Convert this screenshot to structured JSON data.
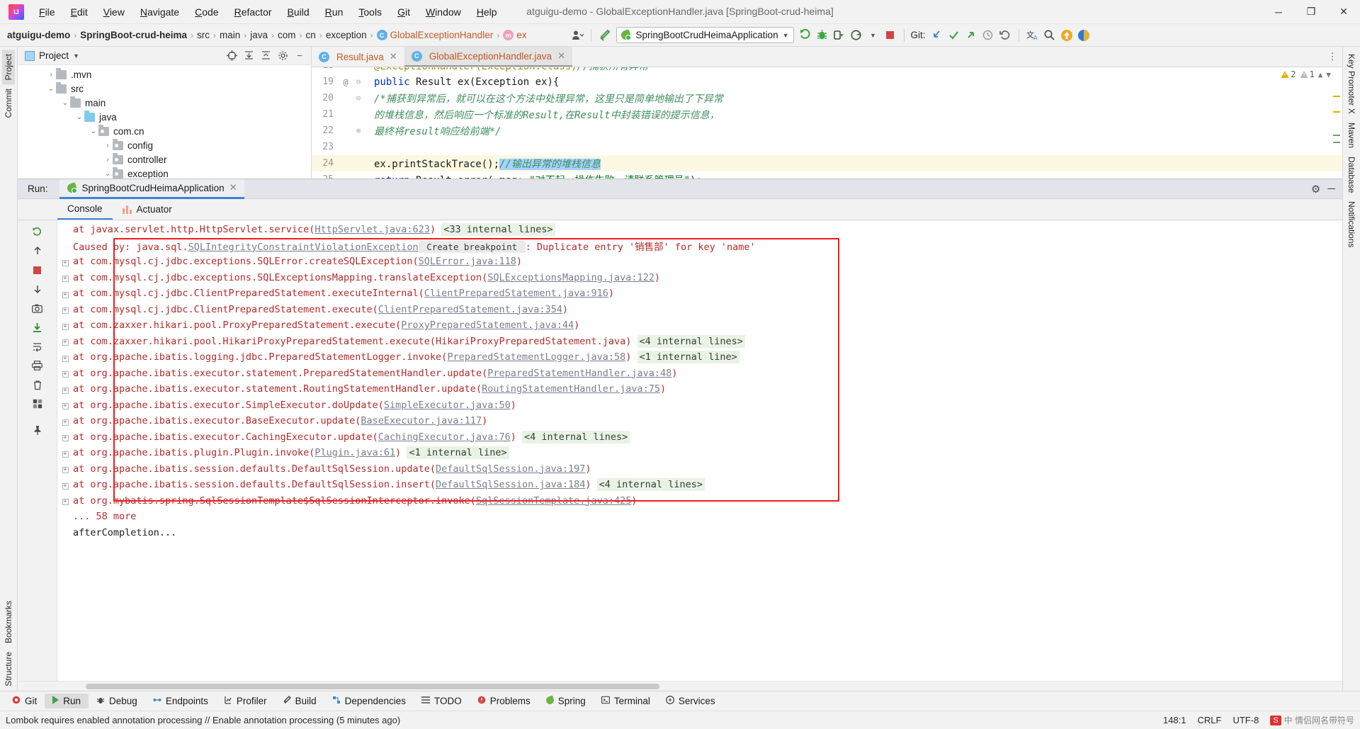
{
  "titlebar": {
    "logo": "intellij-logo",
    "window_title": "atguigu-demo - GlobalExceptionHandler.java [SpringBoot-crud-heima]",
    "menus": [
      "File",
      "Edit",
      "View",
      "Navigate",
      "Code",
      "Refactor",
      "Build",
      "Run",
      "Tools",
      "Git",
      "Window",
      "Help"
    ],
    "minimize": "─",
    "maximize": "❐",
    "close": "✕"
  },
  "navbar": {
    "breadcrumbs": [
      {
        "label": "atguigu-demo",
        "bold": true
      },
      {
        "label": "SpringBoot-crud-heima",
        "bold": true
      },
      {
        "label": "src",
        "bold": false
      },
      {
        "label": "main",
        "bold": false
      },
      {
        "label": "java",
        "bold": false
      },
      {
        "label": "com",
        "bold": false
      },
      {
        "label": "cn",
        "bold": false
      },
      {
        "label": "exception",
        "bold": false
      }
    ],
    "class_crumb": {
      "icon": "C",
      "label": "GlobalExceptionHandler"
    },
    "method_crumb": {
      "icon": "m",
      "label": "ex"
    },
    "run_config": "SpringBootCrudHeimaApplication",
    "git_label": "Git:",
    "separator": "›"
  },
  "left_stripe": {
    "items": [
      "Project",
      "Commit"
    ],
    "selected": "Project",
    "bottom_items": [
      "Bookmarks",
      "Structure"
    ]
  },
  "right_stripe": {
    "items": [
      "Key Promoter X",
      "Maven",
      "Database",
      "Notifications"
    ]
  },
  "project_panel": {
    "title": "Project",
    "tree": [
      {
        "label": ".mvn",
        "indent": 2,
        "arrow": "›",
        "kind": "folder"
      },
      {
        "label": "src",
        "indent": 2,
        "arrow": "⌄",
        "kind": "folder"
      },
      {
        "label": "main",
        "indent": 3,
        "arrow": "⌄",
        "kind": "folder"
      },
      {
        "label": "java",
        "indent": 4,
        "arrow": "⌄",
        "kind": "source"
      },
      {
        "label": "com.cn",
        "indent": 5,
        "arrow": "⌄",
        "kind": "package"
      },
      {
        "label": "config",
        "indent": 6,
        "arrow": "›",
        "kind": "package"
      },
      {
        "label": "controller",
        "indent": 6,
        "arrow": "›",
        "kind": "package"
      },
      {
        "label": "exception",
        "indent": 6,
        "arrow": "⌄",
        "kind": "package"
      }
    ]
  },
  "editor": {
    "tabs": [
      {
        "label": "Result.java",
        "icon": "C",
        "active": false
      },
      {
        "label": "GlobalExceptionHandler.java",
        "icon": "C",
        "active": true
      }
    ],
    "warnings": {
      "warn_count": "2",
      "weak_count": "1",
      "warn_icon": "⚠",
      "weak_icon": "⚠"
    },
    "lines": [
      {
        "num": "18",
        "mark": "",
        "fold": "",
        "highlight": false,
        "clipped": true,
        "segments": [
          {
            "t": "    ",
            "c": "plain"
          },
          {
            "t": "@ExceptionHandler(Exception.class)",
            "c": "ann"
          },
          {
            "t": "//捕获所有异常",
            "c": "cmt"
          }
        ]
      },
      {
        "num": "19",
        "mark": "@",
        "fold": "⊖",
        "highlight": false,
        "segments": [
          {
            "t": "    ",
            "c": "plain"
          },
          {
            "t": "public",
            "c": "kw"
          },
          {
            "t": " Result ",
            "c": "plain"
          },
          {
            "t": "ex",
            "c": "plain"
          },
          {
            "t": "(Exception ex){",
            "c": "plain"
          }
        ]
      },
      {
        "num": "20",
        "mark": "",
        "fold": "⊖",
        "highlight": false,
        "segments": [
          {
            "t": "        ",
            "c": "plain"
          },
          {
            "t": "/*捕获到异常后，就可以在这个方法中处理异常，这里只是简单地输出了下异常",
            "c": "cmt"
          }
        ]
      },
      {
        "num": "21",
        "mark": "",
        "fold": "",
        "highlight": false,
        "segments": [
          {
            "t": "        ",
            "c": "plain"
          },
          {
            "t": "的堆栈信息，然后响应一个标准的Result,在Result中封装错误的提示信息，",
            "c": "cmt"
          }
        ]
      },
      {
        "num": "22",
        "mark": "",
        "fold": "⊕",
        "highlight": false,
        "segments": [
          {
            "t": "        ",
            "c": "plain"
          },
          {
            "t": "最终将result响应给前端*/",
            "c": "cmt"
          }
        ]
      },
      {
        "num": "23",
        "mark": "",
        "fold": "",
        "highlight": false,
        "segments": []
      },
      {
        "num": "24",
        "mark": "",
        "fold": "",
        "highlight": true,
        "segments": [
          {
            "t": "        ",
            "c": "plain"
          },
          {
            "t": "ex.printStackTrace();",
            "c": "plain"
          },
          {
            "t": "//输出异常的堆栈信息",
            "c": "cmtsel"
          }
        ]
      },
      {
        "num": "25",
        "mark": "",
        "fold": "",
        "highlight": false,
        "clipped": true,
        "segments": [
          {
            "t": "        ",
            "c": "plain"
          },
          {
            "t": "return",
            "c": "kw"
          },
          {
            "t": " Result.error( msg: ",
            "c": "plain"
          },
          {
            "t": "\"对不起，操作失败，请联系管理员\"",
            "c": "str"
          },
          {
            "t": ");",
            "c": "plain"
          }
        ]
      }
    ]
  },
  "run_window": {
    "header_label": "Run:",
    "tab_label": "SpringBootCrudHeimaApplication",
    "tab_close": "✕",
    "settings_icon": "⚙",
    "minimize_icon": "─",
    "subtabs": [
      {
        "label": "Console",
        "active": true,
        "icon": ""
      },
      {
        "label": "Actuator",
        "active": false,
        "icon": "actuator-icon"
      }
    ],
    "side_buttons": [
      "rerun-icon",
      "up-arrow-icon",
      "stop-icon",
      "down-arrow-icon",
      "camera-icon",
      "scroll-to-end-icon",
      "soft-wrap-icon",
      "print-icon",
      "trash-icon",
      "grid-icon",
      "pin-icon"
    ],
    "console_lines": [
      {
        "fold": false,
        "highlight": false,
        "parts": [
          {
            "t": "    at javax.servlet.http.HttpServlet.service(",
            "c": "red"
          },
          {
            "t": "HttpServlet.java:623",
            "c": "link"
          },
          {
            "t": ")",
            "c": "red"
          },
          {
            "t": "  ",
            "c": "red"
          },
          {
            "t": "<33 internal lines>",
            "c": "green"
          }
        ]
      },
      {
        "fold": false,
        "highlight": false,
        "parts": [
          {
            "t": "Caused by: java.sql.",
            "c": "red"
          },
          {
            "t": "SQLIntegrityConstraintViolationException",
            "c": "link"
          },
          {
            "t": " Create breakpoint ",
            "c": "bp"
          },
          {
            "t": ": Duplicate entry '销售部' for key 'name'",
            "c": "red"
          }
        ]
      },
      {
        "fold": true,
        "highlight": false,
        "parts": [
          {
            "t": "    at com.mysql.cj.jdbc.exceptions.SQLError.createSQLException(",
            "c": "red"
          },
          {
            "t": "SQLError.java:118",
            "c": "link"
          },
          {
            "t": ")",
            "c": "red"
          }
        ]
      },
      {
        "fold": true,
        "highlight": false,
        "parts": [
          {
            "t": "    at com.mysql.cj.jdbc.exceptions.SQLExceptionsMapping.translateException(",
            "c": "red"
          },
          {
            "t": "SQLExceptionsMapping.java:122",
            "c": "link"
          },
          {
            "t": ")",
            "c": "red"
          }
        ]
      },
      {
        "fold": true,
        "highlight": false,
        "parts": [
          {
            "t": "    at com.mysql.cj.jdbc.ClientPreparedStatement.executeInternal(",
            "c": "red"
          },
          {
            "t": "ClientPreparedStatement.java:916",
            "c": "link"
          },
          {
            "t": ")",
            "c": "red"
          }
        ]
      },
      {
        "fold": true,
        "highlight": false,
        "parts": [
          {
            "t": "    at com.mysql.cj.jdbc.ClientPreparedStatement.execute(",
            "c": "red"
          },
          {
            "t": "ClientPreparedStatement.java:354",
            "c": "link"
          },
          {
            "t": ")",
            "c": "red"
          }
        ]
      },
      {
        "fold": true,
        "highlight": false,
        "parts": [
          {
            "t": "    at com.zaxxer.hikari.pool.ProxyPreparedStatement.execute(",
            "c": "red"
          },
          {
            "t": "ProxyPreparedStatement.java:44",
            "c": "link"
          },
          {
            "t": ")",
            "c": "red"
          }
        ]
      },
      {
        "fold": true,
        "highlight": false,
        "parts": [
          {
            "t": "    at com.zaxxer.hikari.pool.HikariProxyPreparedStatement.execute(HikariProxyPreparedStatement.java)",
            "c": "red"
          },
          {
            "t": "  ",
            "c": "red"
          },
          {
            "t": "<4 internal lines>",
            "c": "green"
          }
        ]
      },
      {
        "fold": true,
        "highlight": false,
        "parts": [
          {
            "t": "    at org.apache.ibatis.logging.jdbc.PreparedStatementLogger.invoke(",
            "c": "red"
          },
          {
            "t": "PreparedStatementLogger.java:58",
            "c": "link"
          },
          {
            "t": ")",
            "c": "red"
          },
          {
            "t": "  ",
            "c": "red"
          },
          {
            "t": "<1 internal line>",
            "c": "green"
          }
        ]
      },
      {
        "fold": true,
        "highlight": false,
        "parts": [
          {
            "t": "    at org.apache.ibatis.executor.statement.PreparedStatementHandler.update(",
            "c": "red"
          },
          {
            "t": "PreparedStatementHandler.java:48",
            "c": "link"
          },
          {
            "t": ")",
            "c": "red"
          }
        ]
      },
      {
        "fold": true,
        "highlight": false,
        "parts": [
          {
            "t": "    at org.apache.ibatis.executor.statement.RoutingStatementHandler.update(",
            "c": "red"
          },
          {
            "t": "RoutingStatementHandler.java:75",
            "c": "link"
          },
          {
            "t": ")",
            "c": "red"
          }
        ]
      },
      {
        "fold": true,
        "highlight": false,
        "parts": [
          {
            "t": "    at org.apache.ibatis.executor.SimpleExecutor.doUpdate(",
            "c": "red"
          },
          {
            "t": "SimpleExecutor.java:50",
            "c": "link"
          },
          {
            "t": ")",
            "c": "red"
          }
        ]
      },
      {
        "fold": true,
        "highlight": false,
        "parts": [
          {
            "t": "    at org.apache.ibatis.executor.BaseExecutor.update(",
            "c": "red"
          },
          {
            "t": "BaseExecutor.java:117",
            "c": "link"
          },
          {
            "t": ")",
            "c": "red"
          }
        ]
      },
      {
        "fold": true,
        "highlight": false,
        "parts": [
          {
            "t": "    at org.apache.ibatis.executor.CachingExecutor.update(",
            "c": "red"
          },
          {
            "t": "CachingExecutor.java:76",
            "c": "link"
          },
          {
            "t": ")",
            "c": "red"
          },
          {
            "t": "  ",
            "c": "red"
          },
          {
            "t": "<4 internal lines>",
            "c": "green"
          }
        ]
      },
      {
        "fold": true,
        "highlight": false,
        "parts": [
          {
            "t": "    at org.apache.ibatis.plugin.Plugin.invoke(",
            "c": "red"
          },
          {
            "t": "Plugin.java:61",
            "c": "link"
          },
          {
            "t": ")",
            "c": "red"
          },
          {
            "t": "  ",
            "c": "red"
          },
          {
            "t": "<1 internal line>",
            "c": "green"
          }
        ]
      },
      {
        "fold": true,
        "highlight": false,
        "parts": [
          {
            "t": "    at org.apache.ibatis.session.defaults.DefaultSqlSession.update(",
            "c": "red"
          },
          {
            "t": "DefaultSqlSession.java:197",
            "c": "link"
          },
          {
            "t": ")",
            "c": "red"
          }
        ]
      },
      {
        "fold": true,
        "highlight": false,
        "parts": [
          {
            "t": "    at org.apache.ibatis.session.defaults.DefaultSqlSession.insert(",
            "c": "red"
          },
          {
            "t": "DefaultSqlSession.java:184",
            "c": "link"
          },
          {
            "t": ")",
            "c": "red"
          },
          {
            "t": "  ",
            "c": "red"
          },
          {
            "t": "<4 internal lines>",
            "c": "green"
          }
        ]
      },
      {
        "fold": true,
        "highlight": false,
        "parts": [
          {
            "t": "    at org.mybatis.spring.SqlSessionTemplate$SqlSessionInterceptor.invoke(",
            "c": "red"
          },
          {
            "t": "SqlSessionTemplate.java:425",
            "c": "link"
          },
          {
            "t": ")",
            "c": "red"
          }
        ]
      },
      {
        "fold": false,
        "highlight": false,
        "parts": [
          {
            "t": "    ... 58 more",
            "c": "red"
          }
        ]
      },
      {
        "fold": false,
        "highlight": false,
        "parts": [
          {
            "t": "afterCompletion...",
            "c": "black"
          }
        ]
      }
    ]
  },
  "bottom_stripe": {
    "items": [
      {
        "label": "Git",
        "icon": "git-icon",
        "active": false
      },
      {
        "label": "Run",
        "icon": "run-icon",
        "active": true
      },
      {
        "label": "Debug",
        "icon": "debug-icon",
        "active": false
      },
      {
        "label": "Endpoints",
        "icon": "endpoints-icon",
        "active": false
      },
      {
        "label": "Profiler",
        "icon": "profiler-icon",
        "active": false
      },
      {
        "label": "Build",
        "icon": "build-icon",
        "active": false
      },
      {
        "label": "Dependencies",
        "icon": "dependencies-icon",
        "active": false
      },
      {
        "label": "TODO",
        "icon": "todo-icon",
        "active": false
      },
      {
        "label": "Problems",
        "icon": "problems-icon",
        "active": false
      },
      {
        "label": "Spring",
        "icon": "spring-icon",
        "active": false
      },
      {
        "label": "Terminal",
        "icon": "terminal-icon",
        "active": false
      },
      {
        "label": "Services",
        "icon": "services-icon",
        "active": false
      }
    ]
  },
  "status_bar": {
    "message": "Lombok requires enabled annotation processing // Enable annotation processing (5 minutes ago)",
    "caret": "148:1",
    "line_sep": "CRLF",
    "encoding": "UTF-8",
    "watermark_tag": "S",
    "watermark_text": "中 情侣网名带符号"
  },
  "colors": {
    "accent_blue": "#3f83d6",
    "error_red": "#b32b2b",
    "box_red": "#ee1c1c",
    "spring_green": "#6db33f",
    "link_gray": "#7a7f8c",
    "comment_green": "#3f8f5e",
    "keyword_blue": "#0033b3"
  }
}
